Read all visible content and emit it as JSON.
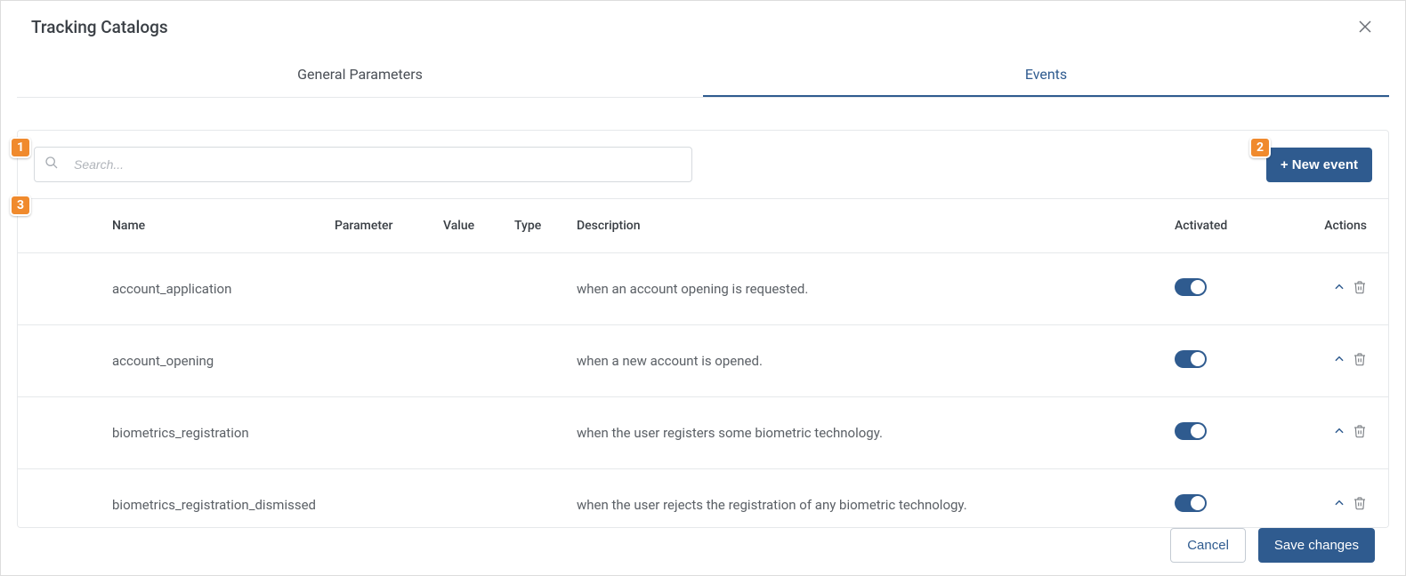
{
  "title": "Tracking Catalogs",
  "tabs": {
    "general": "General Parameters",
    "events": "Events"
  },
  "search": {
    "placeholder": "Search..."
  },
  "buttons": {
    "new_event": "+ New event",
    "cancel": "Cancel",
    "save": "Save changes"
  },
  "columns": {
    "name": "Name",
    "parameter": "Parameter",
    "value": "Value",
    "type": "Type",
    "description": "Description",
    "activated": "Activated",
    "actions": "Actions"
  },
  "rows": [
    {
      "name": "account_application",
      "parameter": "",
      "value": "",
      "type": "",
      "description": "when an account opening is requested.",
      "activated": true
    },
    {
      "name": "account_opening",
      "parameter": "",
      "value": "",
      "type": "",
      "description": "when a new account is opened.",
      "activated": true
    },
    {
      "name": "biometrics_registration",
      "parameter": "",
      "value": "",
      "type": "",
      "description": "when the user registers some biometric technology.",
      "activated": true
    },
    {
      "name": "biometrics_registration_dismissed",
      "parameter": "",
      "value": "",
      "type": "",
      "description": "when the user rejects the registration of any biometric technology.",
      "activated": true
    }
  ],
  "callouts": {
    "search": "1",
    "new_event": "2",
    "table": "3"
  }
}
